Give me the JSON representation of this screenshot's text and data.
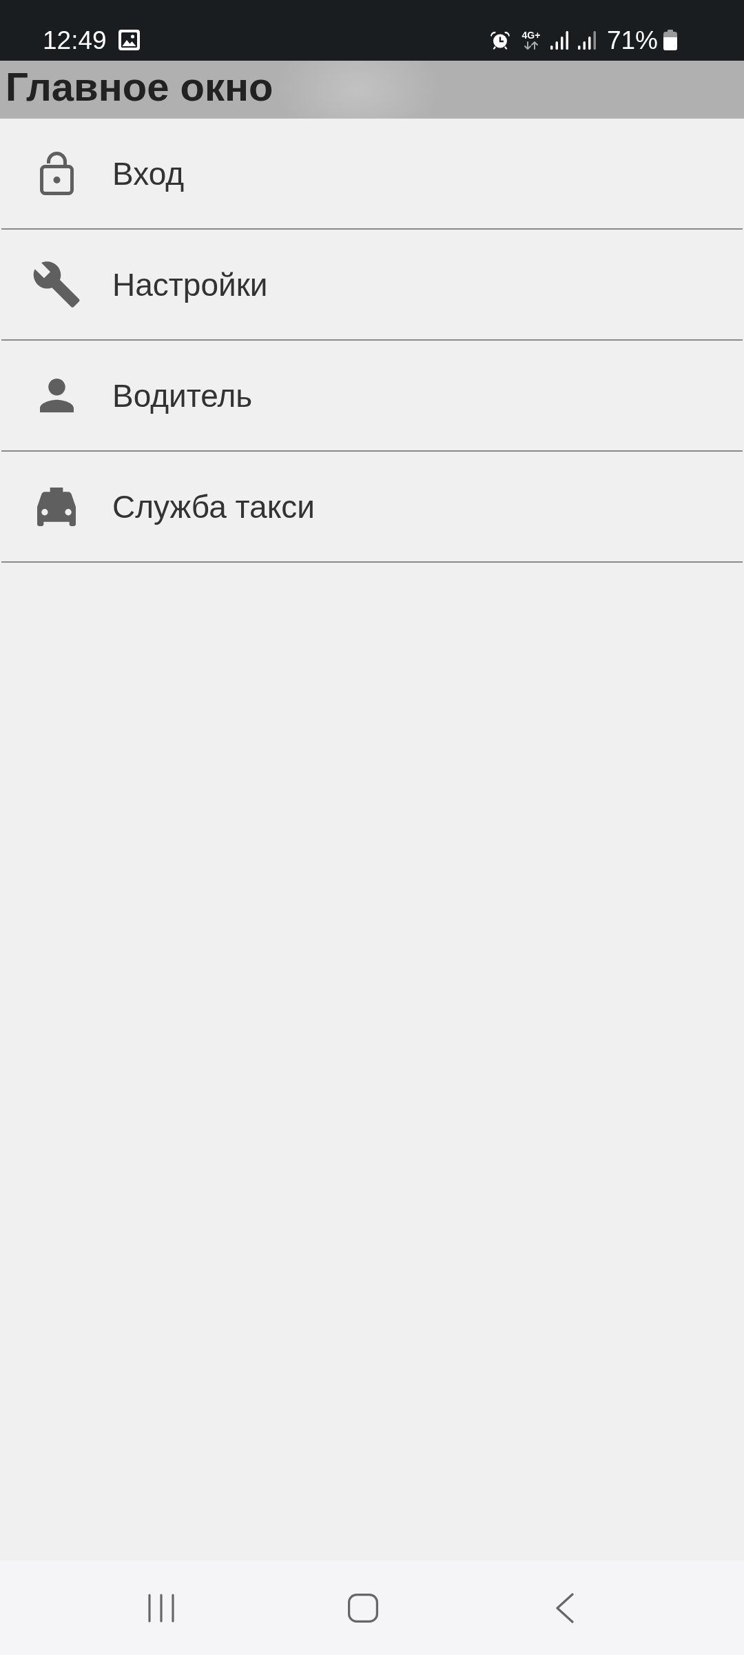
{
  "status_bar": {
    "time": "12:49",
    "network": "4G+",
    "battery": "71%"
  },
  "title_bar": {
    "title": "Главное окно"
  },
  "menu": {
    "items": [
      {
        "label": "Вход"
      },
      {
        "label": "Настройки"
      },
      {
        "label": "Водитель"
      },
      {
        "label": "Служба такси"
      }
    ]
  }
}
